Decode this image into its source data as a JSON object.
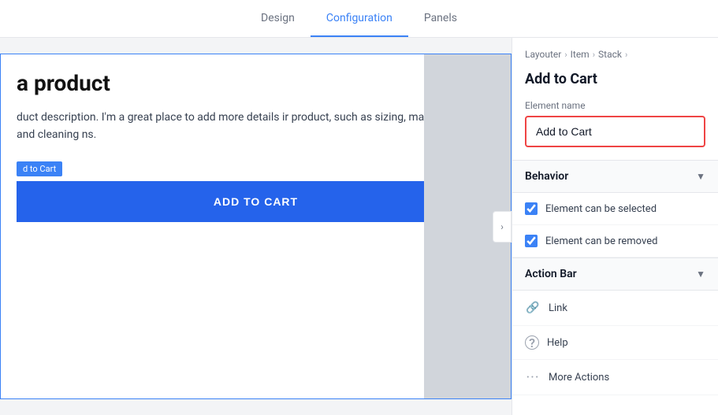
{
  "nav": {
    "tabs": [
      {
        "id": "design",
        "label": "Design",
        "active": false
      },
      {
        "id": "configuration",
        "label": "Configuration",
        "active": true
      },
      {
        "id": "panels",
        "label": "Panels",
        "active": false
      }
    ]
  },
  "preview": {
    "toggle_icon": "›",
    "product_title": "a product",
    "product_description": "duct description. I'm a great place to add more details\nir product, such as sizing, material, care and cleaning\nns.",
    "badge_label": "d to Cart",
    "button_label": "ADD TO CART"
  },
  "config": {
    "breadcrumb": {
      "items": [
        "Layouter",
        "Item",
        "Stack"
      ]
    },
    "section_title": "Add to Cart",
    "element_name_label": "Element name",
    "element_name_value": "Add to Cart",
    "element_name_placeholder": "Add to Cart",
    "behavior_section": {
      "label": "Behavior",
      "arrow": "▼",
      "checkboxes": [
        {
          "id": "can-select",
          "label": "Element can be selected",
          "checked": true
        },
        {
          "id": "can-remove",
          "label": "Element can be removed",
          "checked": true
        }
      ]
    },
    "action_bar_section": {
      "label": "Action Bar",
      "arrow": "▼",
      "items": [
        {
          "id": "link",
          "icon": "🔗",
          "label": "Link"
        },
        {
          "id": "help",
          "icon": "?",
          "label": "Help"
        },
        {
          "id": "more-actions",
          "icon": "•••",
          "label": "More Actions"
        }
      ]
    }
  }
}
